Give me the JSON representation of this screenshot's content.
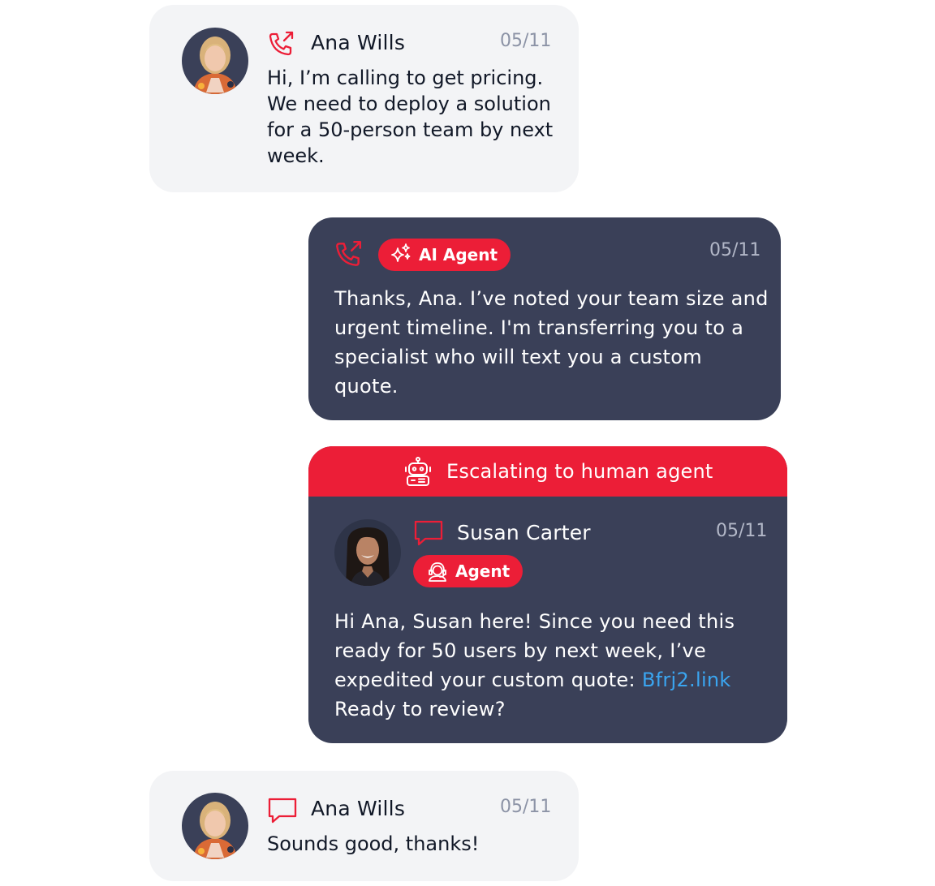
{
  "messages": [
    {
      "sender": "Ana Wills",
      "date": "05/11",
      "channel_icon": "phone-outgoing-icon",
      "text_lines": [
        "Hi, I’m calling to get pricing.",
        "We need to deploy a solution",
        "for a 50-person team by next",
        "week."
      ]
    },
    {
      "badge": "AI Agent",
      "badge_icon": "sparkles-icon",
      "date": "05/11",
      "channel_icon": "phone-outgoing-icon",
      "text_lines": [
        "Thanks, Ana. I’ve noted your team size and",
        "urgent timeline. I'm transferring you to a",
        "specialist who will text you a custom",
        "quote."
      ]
    },
    {
      "banner": "Escalating to human agent",
      "banner_icon": "robot-icon",
      "sender": "Susan Carter",
      "badge": "Agent",
      "badge_icon": "headset-agent-icon",
      "date": "05/11",
      "channel_icon": "chat-bubble-icon",
      "text_lines": [
        "Hi Ana, Susan here! Since you need this",
        "ready for 50 users by next week, I’ve",
        "expedited your custom quote: ",
        "Ready to review?"
      ],
      "link": "Bfrj2.link"
    },
    {
      "sender": "Ana Wills",
      "date": "05/11",
      "channel_icon": "chat-bubble-icon",
      "text": "Sounds good, thanks!"
    }
  ],
  "colors": {
    "accent": "#ec1e37",
    "dark_card": "#3a4058",
    "light_card": "#f3f4f6",
    "link": "#3aa5f0"
  }
}
